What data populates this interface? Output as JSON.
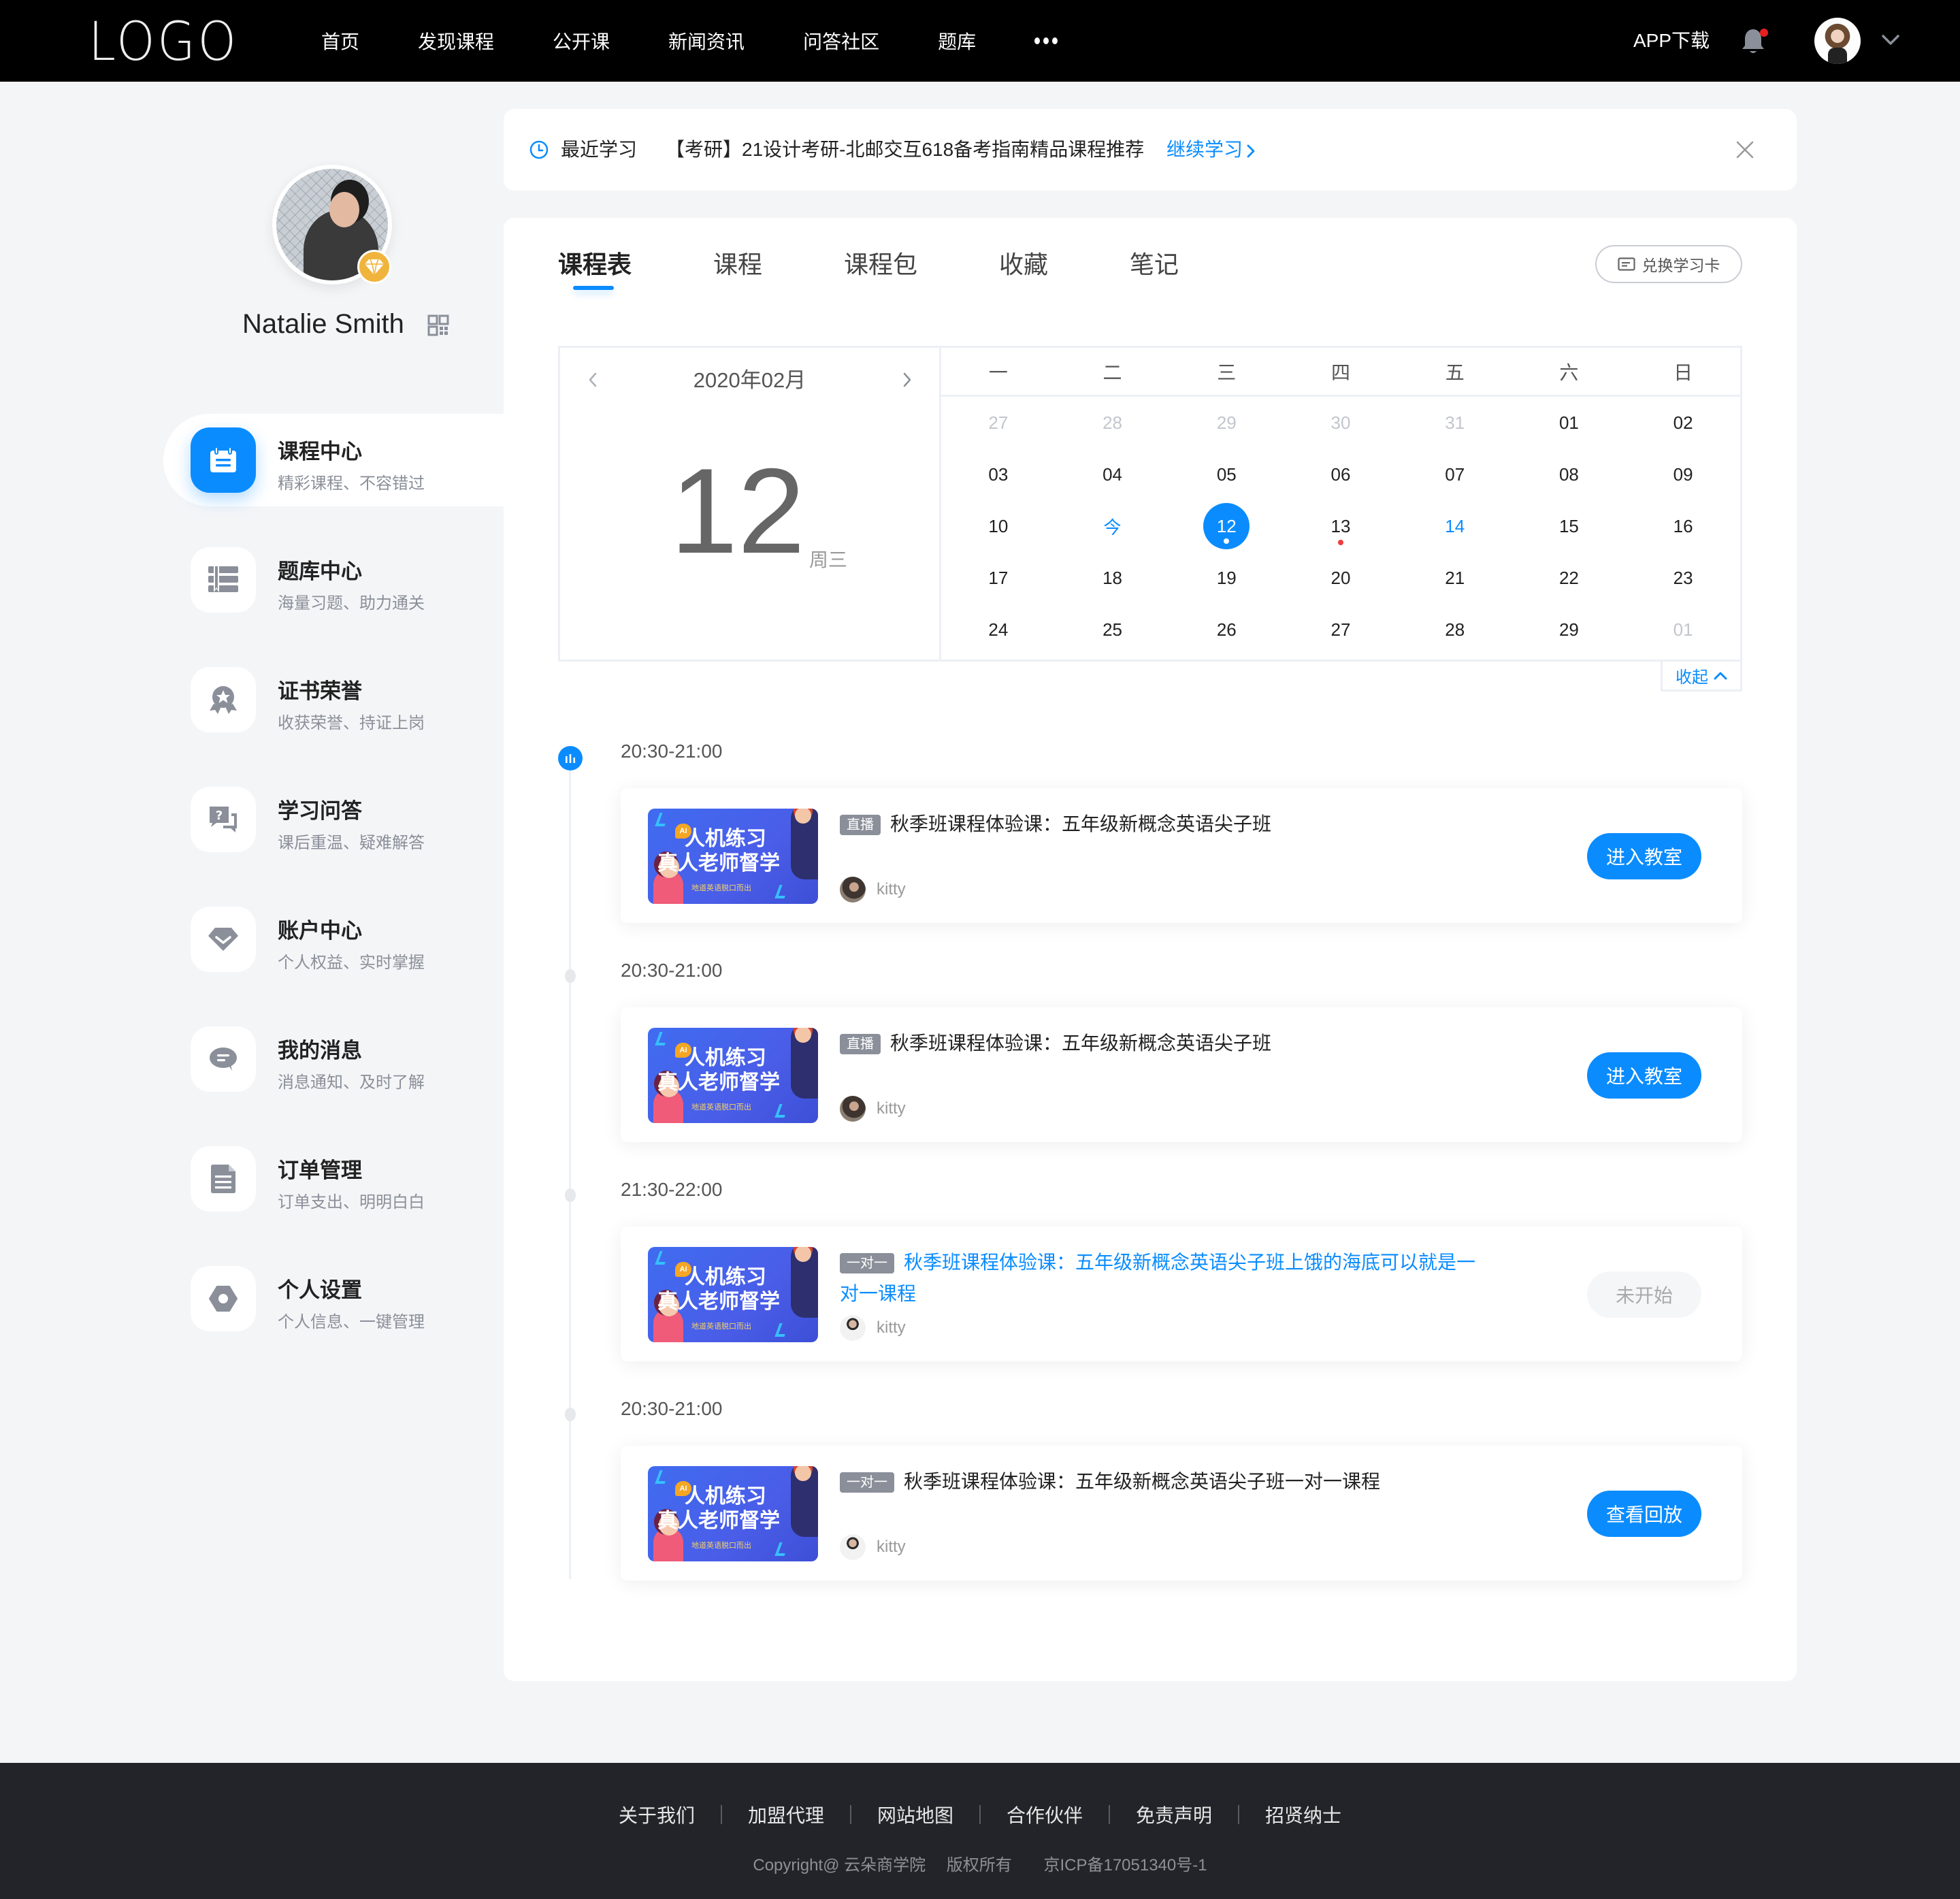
{
  "header": {
    "logo": "LOGO",
    "nav": [
      "首页",
      "发现课程",
      "公开课",
      "新闻资讯",
      "问答社区",
      "题库"
    ],
    "more_icon": "ellipsis-icon",
    "app_download": "APP下载",
    "notification_icon": "bell-icon",
    "has_unread_notification": true,
    "user_menu_icon": "chevron-down-icon"
  },
  "profile": {
    "name": "Natalie Smith",
    "badge_icon": "diamond-icon",
    "qr_icon": "qrcode-icon"
  },
  "sidebar": {
    "items": [
      {
        "title": "课程中心",
        "subtitle": "精彩课程、不容错过",
        "icon": "calendar-icon",
        "active": true
      },
      {
        "title": "题库中心",
        "subtitle": "海量习题、助力通关",
        "icon": "book-list-icon",
        "active": false
      },
      {
        "title": "证书荣誉",
        "subtitle": "收获荣誉、持证上岗",
        "icon": "medal-icon",
        "active": false
      },
      {
        "title": "学习问答",
        "subtitle": "课后重温、疑难解答",
        "icon": "question-chat-icon",
        "active": false
      },
      {
        "title": "账户中心",
        "subtitle": "个人权益、实时掌握",
        "icon": "gem-icon",
        "active": false
      },
      {
        "title": "我的消息",
        "subtitle": "消息通知、及时了解",
        "icon": "message-icon",
        "active": false
      },
      {
        "title": "订单管理",
        "subtitle": "订单支出、明明白白",
        "icon": "document-icon",
        "active": false
      },
      {
        "title": "个人设置",
        "subtitle": "个人信息、一键管理",
        "icon": "gear-icon",
        "active": false
      }
    ]
  },
  "recent": {
    "label": "最近学习",
    "course": "【考研】21设计考研-北邮交互618备考指南精品课程推荐",
    "continue": "继续学习",
    "close_icon": "close-icon"
  },
  "tabs": [
    {
      "label": "课程表",
      "active": true
    },
    {
      "label": "课程",
      "active": false
    },
    {
      "label": "课程包",
      "active": false
    },
    {
      "label": "收藏",
      "active": false
    },
    {
      "label": "笔记",
      "active": false
    }
  ],
  "redeem_button": "兑换学习卡",
  "calendar": {
    "month_label": "2020年02月",
    "big_day": "12",
    "weekday": "周三",
    "week_headers": [
      "一",
      "二",
      "三",
      "四",
      "五",
      "六",
      "日"
    ],
    "days": [
      {
        "label": "27",
        "state": "muted"
      },
      {
        "label": "28",
        "state": "muted"
      },
      {
        "label": "29",
        "state": "muted"
      },
      {
        "label": "30",
        "state": "muted"
      },
      {
        "label": "31",
        "state": "muted"
      },
      {
        "label": "01",
        "state": "normal"
      },
      {
        "label": "02",
        "state": "normal"
      },
      {
        "label": "03",
        "state": "normal"
      },
      {
        "label": "04",
        "state": "normal"
      },
      {
        "label": "05",
        "state": "normal"
      },
      {
        "label": "06",
        "state": "normal"
      },
      {
        "label": "07",
        "state": "normal"
      },
      {
        "label": "08",
        "state": "normal"
      },
      {
        "label": "09",
        "state": "normal"
      },
      {
        "label": "10",
        "state": "normal"
      },
      {
        "label": "今",
        "state": "today"
      },
      {
        "label": "12",
        "state": "selected",
        "dot": "white"
      },
      {
        "label": "13",
        "state": "normal",
        "dot": "red"
      },
      {
        "label": "14",
        "state": "blue"
      },
      {
        "label": "15",
        "state": "normal"
      },
      {
        "label": "16",
        "state": "normal"
      },
      {
        "label": "17",
        "state": "normal"
      },
      {
        "label": "18",
        "state": "normal"
      },
      {
        "label": "19",
        "state": "normal"
      },
      {
        "label": "20",
        "state": "normal"
      },
      {
        "label": "21",
        "state": "normal"
      },
      {
        "label": "22",
        "state": "normal"
      },
      {
        "label": "23",
        "state": "normal"
      },
      {
        "label": "24",
        "state": "normal"
      },
      {
        "label": "25",
        "state": "normal"
      },
      {
        "label": "26",
        "state": "normal"
      },
      {
        "label": "27",
        "state": "normal"
      },
      {
        "label": "28",
        "state": "normal"
      },
      {
        "label": "29",
        "state": "normal"
      },
      {
        "label": "01",
        "state": "muted"
      }
    ],
    "collapse_label": "收起"
  },
  "schedule": [
    {
      "time": "20:30-21:00",
      "node_active": true,
      "badge": "直播",
      "title": "秋季班课程体验课：五年级新概念英语尖子班",
      "title_highlight": false,
      "teacher": "kitty",
      "button": "进入教室",
      "button_state": "primary"
    },
    {
      "time": "20:30-21:00",
      "node_active": false,
      "badge": "直播",
      "title": "秋季班课程体验课：五年级新概念英语尖子班",
      "title_highlight": false,
      "teacher": "kitty",
      "button": "进入教室",
      "button_state": "primary"
    },
    {
      "time": "21:30-22:00",
      "node_active": false,
      "badge": "一对一",
      "title": "秋季班课程体验课：五年级新概念英语尖子班上饿的海底可以就是一对一课程",
      "title_highlight": true,
      "teacher": "kitty",
      "button": "未开始",
      "button_state": "disabled"
    },
    {
      "time": "20:30-21:00",
      "node_active": false,
      "badge": "一对一",
      "title": "秋季班课程体验课：五年级新概念英语尖子班一对一课程",
      "title_highlight": false,
      "teacher": "kitty",
      "button": "查看回放",
      "button_state": "primary"
    }
  ],
  "thumbnail": {
    "ai_tag": "AI",
    "line1": "人机练习",
    "line2": "真人老师督学",
    "line3": "地道英语脱口而出"
  },
  "footer": {
    "links": [
      "关于我们",
      "加盟代理",
      "网站地图",
      "合作伙伴",
      "免责声明",
      "招贤纳士"
    ],
    "copyright": "Copyright@ 云朵商学院",
    "rights": "版权所有",
    "icp": "京ICP备17051340号-1"
  },
  "colors": {
    "accent": "#0a8cff",
    "header_bg": "#000000",
    "footer_bg": "#232429",
    "page_bg": "#f4f5f7",
    "notification_dot": "#e61f1f",
    "vip_gold": "#f0b43c"
  }
}
